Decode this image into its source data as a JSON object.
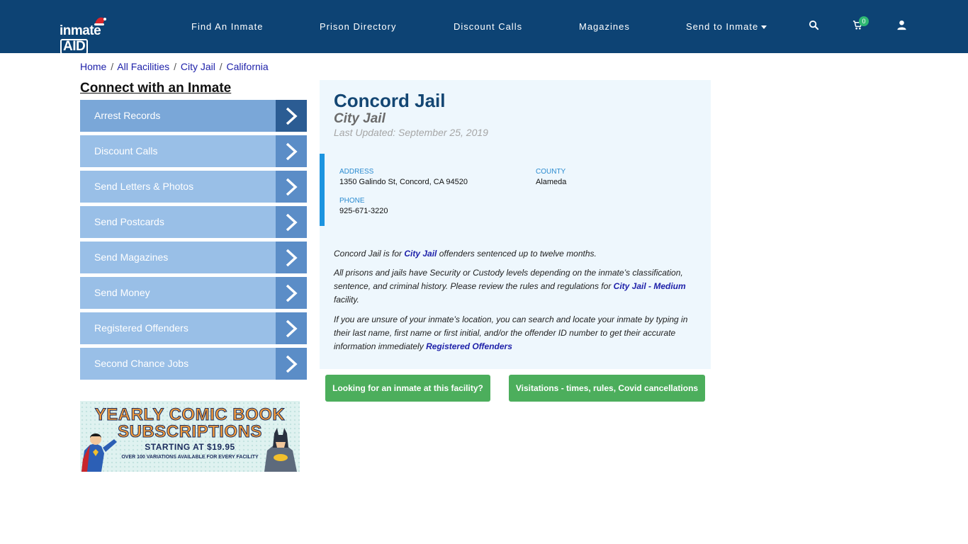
{
  "header": {
    "logo_main": "inmate",
    "logo_aid": "AID",
    "nav": [
      {
        "label": "Find An Inmate"
      },
      {
        "label": "Prison Directory"
      },
      {
        "label": "Discount Calls"
      },
      {
        "label": "Magazines"
      },
      {
        "label": "Send to Inmate"
      }
    ],
    "cart_count": "0",
    "icons": [
      "search-icon",
      "cart-icon",
      "user-icon"
    ]
  },
  "breadcrumb": {
    "items": [
      "Home",
      "All Facilities",
      "City Jail",
      "California"
    ],
    "separator": "/"
  },
  "sidebar": {
    "title": "Connect with an Inmate",
    "items": [
      {
        "label": "Arrest Records"
      },
      {
        "label": "Discount Calls"
      },
      {
        "label": "Send Letters & Photos"
      },
      {
        "label": "Send Postcards"
      },
      {
        "label": "Send Magazines"
      },
      {
        "label": "Send Money"
      },
      {
        "label": "Registered Offenders"
      },
      {
        "label": "Second Chance Jobs"
      }
    ]
  },
  "ad": {
    "line1": "YEARLY COMIC BOOK",
    "line2": "SUBSCRIPTIONS",
    "line3": "STARTING AT $19.95",
    "line4": "OVER 100 VARIATIONS AVAILABLE FOR EVERY FACILITY"
  },
  "facility": {
    "name": "Concord Jail",
    "type": "City Jail",
    "updated": "Last Updated: September 25, 2019",
    "address_label": "ADDRESS",
    "address": "1350 Galindo St, Concord, CA 94520",
    "county_label": "COUNTY",
    "county": "Alameda",
    "phone_label": "PHONE",
    "phone": "925-671-3220"
  },
  "description": {
    "p1_a": "Concord Jail is for ",
    "p1_link": "City Jail",
    "p1_b": " offenders sentenced up to twelve months.",
    "p2_a": "All prisons and jails have Security or Custody levels depending on the inmate’s classification, sentence, and criminal history. Please review the rules and regulations for ",
    "p2_link": "City Jail - Medium",
    "p2_b": " facility.",
    "p3_a": "If you are unsure of your inmate’s location, you can search and locate your inmate by typing in their last name, first name or first initial, and/or the offender ID number to get their accurate information immediately ",
    "p3_link": "Registered Offenders"
  },
  "buttons": {
    "looking": "Looking for an inmate at this facility?",
    "visitations": "Visitations - times, rules, Covid cancellations"
  },
  "colors": {
    "header_bg": "#0d4374",
    "sidebar_item": "#99bfe7",
    "sidebar_arrow": "#5b8dc7",
    "panel_bg": "#eef7fd",
    "accent_blue": "#1c94e0",
    "button_green": "#4cae5c",
    "link": "#1f22aa"
  }
}
